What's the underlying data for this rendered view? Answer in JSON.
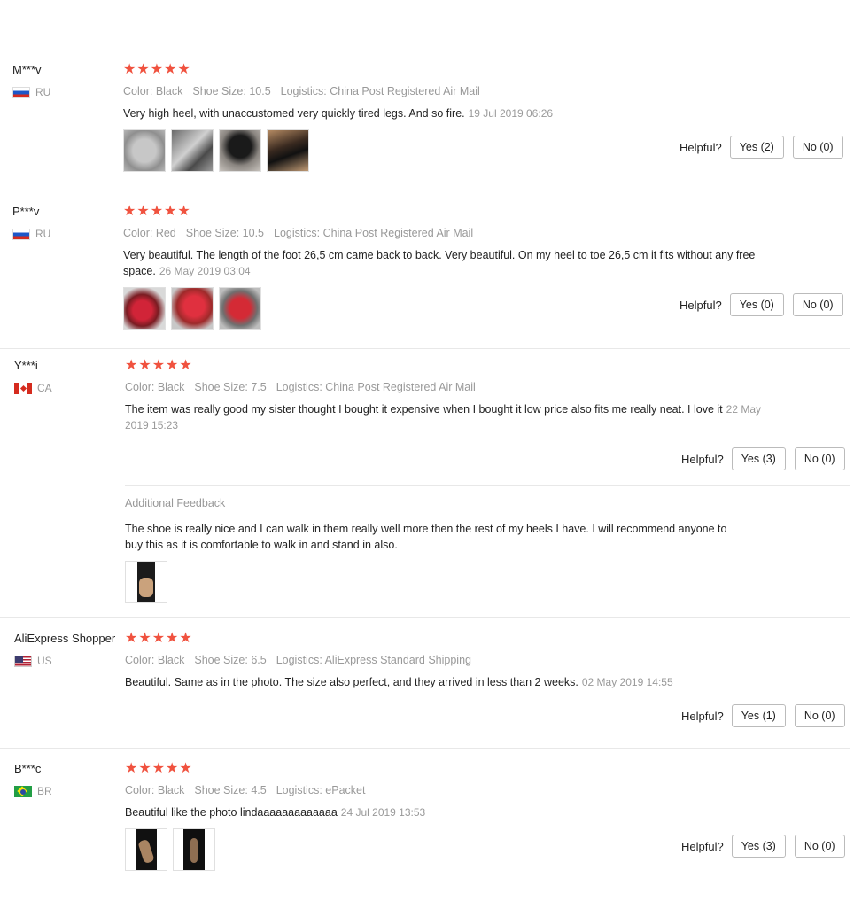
{
  "helpful_label": "Helpful?",
  "accent_star_color": "#f0523f",
  "reviews": [
    {
      "user": "M***v",
      "country": "RU",
      "flag_icon": "russia-flag-icon",
      "rating": 5,
      "stars": "★★★★★",
      "attrs": {
        "color": "Color: Black",
        "size": "Shoe Size: 10.5",
        "logistics": "Logistics: China Post Registered Air Mail"
      },
      "text": "Very high heel, with unaccustomed very quickly tired legs. And so fire.",
      "date": "19 Jul 2019 06:26",
      "photos": [
        "shoe-photo",
        "shoe-photo",
        "shoe-photo",
        "shoe-photo"
      ],
      "yes": "Yes (2)",
      "no": "No (0)"
    },
    {
      "user": "P***v",
      "country": "RU",
      "flag_icon": "russia-flag-icon",
      "rating": 5,
      "stars": "★★★★★",
      "attrs": {
        "color": "Color: Red",
        "size": "Shoe Size: 10.5",
        "logistics": "Logistics: China Post Registered Air Mail"
      },
      "text": "Very beautiful. The length of the foot 26,5 cm came back to back. Very beautiful. On my heel to toe 26,5 cm it fits without any free space.",
      "date": "26 May 2019 03:04",
      "photos": [
        "shoe-photo",
        "shoe-photo",
        "shoe-photo"
      ],
      "yes": "Yes (0)",
      "no": "No (0)"
    },
    {
      "user": "Y***i",
      "country": "CA",
      "flag_icon": "canada-flag-icon",
      "rating": 5,
      "stars": "★★★★★",
      "attrs": {
        "color": "Color: Black",
        "size": "Shoe Size: 7.5",
        "logistics": "Logistics: China Post Registered Air Mail"
      },
      "text": "The item was really good my sister thought I bought it expensive when I bought it low price also fits me really neat. I love it",
      "date": "22 May 2019 15:23",
      "yes": "Yes (3)",
      "no": "No (0)",
      "additional": {
        "title": "Additional Feedback",
        "text": "The shoe is really nice and I can walk in them really well more then the rest of my heels I have. I will recommend anyone to buy this as it is comfortable to walk in and stand in also.",
        "photos": [
          "shoe-photo"
        ]
      }
    },
    {
      "user": "AliExpress Shopper",
      "country": "US",
      "flag_icon": "usa-flag-icon",
      "rating": 5,
      "stars": "★★★★★",
      "attrs": {
        "color": "Color: Black",
        "size": "Shoe Size: 6.5",
        "logistics": "Logistics: AliExpress Standard Shipping"
      },
      "text": "Beautiful. Same as in the photo. The size also perfect, and they arrived in less than 2 weeks.",
      "date": "02 May 2019 14:55",
      "yes": "Yes (1)",
      "no": "No (0)"
    },
    {
      "user": "B***c",
      "country": "BR",
      "flag_icon": "brazil-flag-icon",
      "rating": 5,
      "stars": "★★★★★",
      "attrs": {
        "color": "Color: Black",
        "size": "Shoe Size: 4.5",
        "logistics": "Logistics: ePacket"
      },
      "text": "Beautiful like the photo lindaaaaaaaaaaaaa",
      "date": "24 Jul 2019 13:53",
      "photos": [
        "shoe-photo",
        "shoe-photo"
      ],
      "yes": "Yes (3)",
      "no": "No (0)"
    }
  ]
}
